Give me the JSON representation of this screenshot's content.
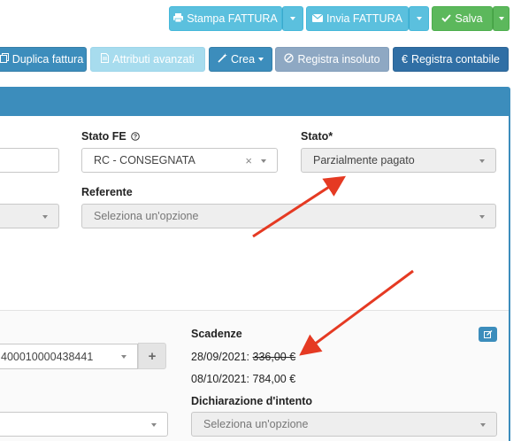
{
  "toolbar": {
    "print_label": "Stampa FATTURA",
    "send_label": "Invia FATTURA",
    "save_label": "Salva",
    "duplicate_label": "Duplica fattura",
    "advanced_label": "Attributi avanzati",
    "create_label": "Crea",
    "unpaid_label": "Registra insoluto",
    "accounting_label": "Registra contabile"
  },
  "form": {
    "stato_fe_label": "Stato FE",
    "stato_fe_value": "RC - CONSEGNATA",
    "stato_label": "Stato*",
    "stato_value": "Parzialmente pagato",
    "referente_label": "Referente",
    "referente_placeholder": "Seleziona un'opzione",
    "bank_value": "400010000438441",
    "scadenze_label": "Scadenze",
    "scadenza_1_date": "28/09/2021:",
    "scadenza_1_amount": "336,00 €",
    "scadenza_2": "08/10/2021: 784,00 €",
    "dichiarazione_label": "Dichiarazione d'intento",
    "dichiarazione_placeholder": "Seleziona un'opzione"
  },
  "colors": {
    "primary": "#3c8dbc",
    "info": "#5bc0de",
    "success": "#5cb85c",
    "annotation_arrow": "#e53a23"
  }
}
